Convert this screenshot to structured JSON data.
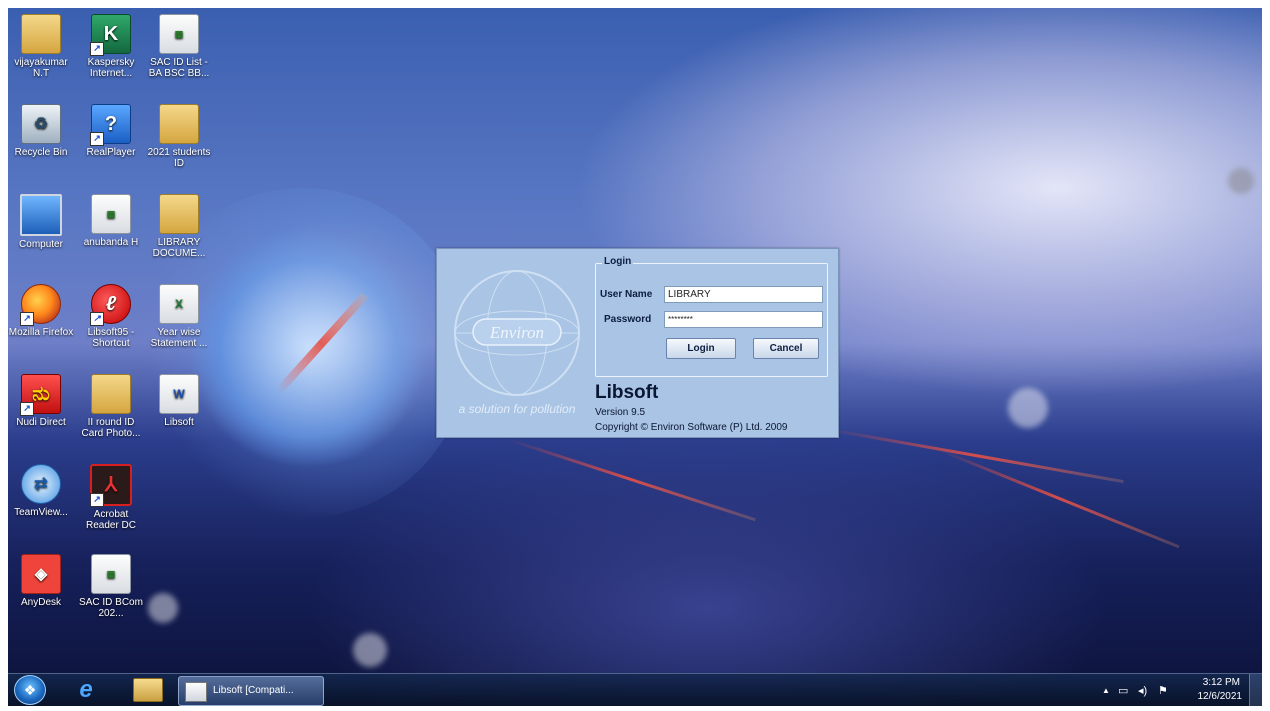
{
  "desktop_icons": [
    {
      "label": "vijayakumar N.T",
      "icon": "user-folder-icon"
    },
    {
      "label": "Kaspersky Internet...",
      "icon": "kaspersky-icon"
    },
    {
      "label": "SAC ID List - BA BSC BB...",
      "icon": "spreadsheet-icon"
    },
    {
      "label": "Recycle Bin",
      "icon": "recycle-bin-icon"
    },
    {
      "label": "RealPlayer",
      "icon": "realplayer-icon"
    },
    {
      "label": "2021 students ID",
      "icon": "folder-icon"
    },
    {
      "label": "Computer",
      "icon": "computer-icon"
    },
    {
      "label": "anubanda H",
      "icon": "spreadsheet-icon"
    },
    {
      "label": "LIBRARY DOCUME...",
      "icon": "folder-icon"
    },
    {
      "label": "Mozilla Firefox",
      "icon": "firefox-icon"
    },
    {
      "label": "Libsoft95 - Shortcut",
      "icon": "libsoft-icon"
    },
    {
      "label": "Year wise Statement ...",
      "icon": "excel-icon"
    },
    {
      "label": "Nudi Direct",
      "icon": "nudi-icon"
    },
    {
      "label": "II round ID Card Photo...",
      "icon": "folder-icon"
    },
    {
      "label": "Libsoft",
      "icon": "word-document-icon"
    },
    {
      "label": "TeamView...",
      "icon": "teamviewer-icon"
    },
    {
      "label": "Acrobat Reader DC",
      "icon": "acrobat-icon"
    },
    {
      "label": "AnyDesk",
      "icon": "anydesk-icon"
    },
    {
      "label": "SAC ID BCom 202...",
      "icon": "spreadsheet-icon"
    }
  ],
  "dialog": {
    "logo_text": "Environ",
    "logo_tagline": "a solution for pollution",
    "login_legend": "Login",
    "username_label": "User Name",
    "username_value": "LIBRARY",
    "password_label": "Password",
    "password_value": "********",
    "login_button": "Login",
    "cancel_button": "Cancel",
    "product_name": "Libsoft",
    "version": "Version 9.5",
    "copyright": "Copyright © Environ Software (P) Ltd. 2009"
  },
  "taskbar": {
    "active_app_label": "Libsoft [Compati...",
    "clock_time": "3:12 PM",
    "clock_date": "12/6/2021"
  }
}
